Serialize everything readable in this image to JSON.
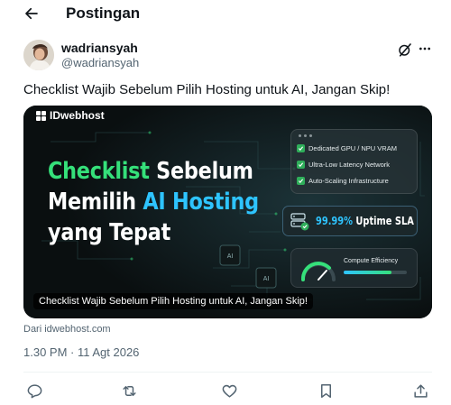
{
  "header": {
    "title": "Postingan",
    "back_icon": "arrow-left-icon"
  },
  "author": {
    "display_name": "wadriansyah",
    "handle": "@wadriansyah",
    "grok_icon": "grok-icon",
    "more_icon": "more-horizontal-icon"
  },
  "tweet": {
    "text": "Checklist Wajib Sebelum Pilih Hosting untuk AI, Jangan Skip!",
    "source": "Dari idwebhost.com",
    "timestamp": "1.30 PM · 11 Agt 2026"
  },
  "card": {
    "brand": "IDwebhost",
    "headline": {
      "line1_green": "Checklist",
      "line1_rest": "Sebelum",
      "line2_start": "Memilih",
      "line2_blue": "AI Hosting",
      "line3": "yang Tepat"
    },
    "features": [
      "Dedicated GPU / NPU VRAM",
      "Ultra-Low Latency Network",
      "Auto-Scaling Infrastructure"
    ],
    "sla_value": "99.99%",
    "sla_label": "Uptime SLA",
    "efficiency_label": "Compute Efficiency",
    "efficiency_fraction": 0.75,
    "chip_label": "AI",
    "caption": "Checklist Wajib Sebelum Pilih Hosting untuk AI, Jangan Skip!",
    "colors": {
      "green": "#35e07a",
      "blue": "#2ec4ff",
      "background": "#0d1213"
    }
  },
  "actions": [
    {
      "name": "reply-button",
      "icon": "reply-icon"
    },
    {
      "name": "repost-button",
      "icon": "repost-icon"
    },
    {
      "name": "like-button",
      "icon": "like-icon"
    },
    {
      "name": "bookmark-button",
      "icon": "bookmark-icon"
    },
    {
      "name": "share-button",
      "icon": "share-icon"
    }
  ]
}
